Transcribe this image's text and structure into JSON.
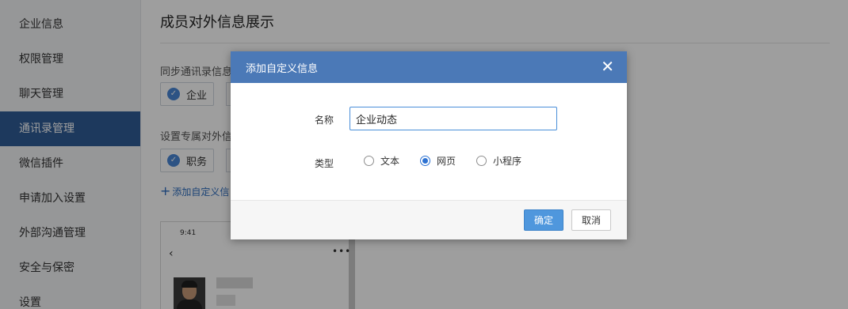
{
  "sidebar": {
    "items": [
      {
        "label": "企业信息"
      },
      {
        "label": "权限管理"
      },
      {
        "label": "聊天管理"
      },
      {
        "label": "通讯录管理",
        "active": true
      },
      {
        "label": "微信插件"
      },
      {
        "label": "申请加入设置"
      },
      {
        "label": "外部沟通管理"
      },
      {
        "label": "安全与保密"
      },
      {
        "label": "设置"
      }
    ]
  },
  "main": {
    "title": "成员对外信息展示",
    "sync_label": "同步通讯录信息",
    "sync_chip": "企业",
    "exclusive_label": "设置专属对外信",
    "exclusive_chip": "职务",
    "add_link": "添加自定义信",
    "phone": {
      "time": "9:41",
      "back_icon": "chevron-left-icon",
      "more_icon": "more-icon"
    }
  },
  "dialog": {
    "title": "添加自定义信息",
    "close_icon": "close-icon",
    "name_label": "名称",
    "name_value": "企业动态",
    "type_label": "类型",
    "type_options": [
      {
        "label": "文本",
        "checked": false
      },
      {
        "label": "网页",
        "checked": true
      },
      {
        "label": "小程序",
        "checked": false
      }
    ],
    "ok_label": "确定",
    "cancel_label": "取消"
  },
  "colors": {
    "sidebar_active": "#2f5c96",
    "dialog_header": "#4b79b7",
    "primary_button": "#4f97dd"
  }
}
